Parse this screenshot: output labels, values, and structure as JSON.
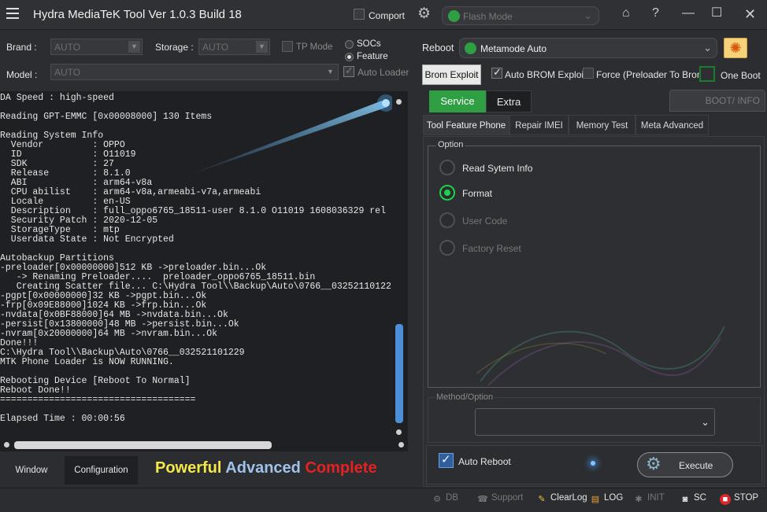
{
  "window": {
    "title": "Hydra MediaTeK Tool  Ver 1.0.3 Build 18",
    "comport_label": "Comport",
    "mode_label": "Flash Mode"
  },
  "controls": {
    "brand_label": "Brand :",
    "brand_value": "AUTO",
    "storage_label": "Storage :",
    "storage_value": "AUTO",
    "tp_mode_label": "TP Mode",
    "model_label": "Model :",
    "model_value": "AUTO",
    "socs_label": "SOCs",
    "feature_label": "Feature",
    "auto_loader_label": "Auto Loader",
    "reboot_label": "Reboot",
    "reboot_value": "Metamode Auto",
    "brom_exploit_label": "Brom Exploit",
    "auto_brom_label": "Auto BROM Exploit",
    "force_label": "Force (Preloader To Brom)",
    "one_boot_label": "One Boot"
  },
  "log": {
    "lines": "DA Speed : high-speed\n\nReading GPT-EMMC [0x00008000] 130 Items\n\nReading System Info\n  Vendor         : OPPO\n  ID             : O11019\n  SDK            : 27\n  Release        : 8.1.0\n  ABI            : arm64-v8a\n  CPU abilist    : arm64-v8a,armeabi-v7a,armeabi\n  Locale         : en-US\n  Description    : full_oppo6765_18511-user 8.1.0 O11019 1608036329 rel\n  Security Patch : 2020-12-05\n  StorageType    : mtp\n  Userdata State : Not Encrypted\n\nAutobackup Partitions\n-preloader[0x00000000]512 KB ->preloader.bin...Ok\n   -> Renaming Preloader....  preloader_oppo6765_18511.bin\n   Creating Scatter file... C:\\Hydra Tool\\\\Backup\\Auto\\0766__03252110122\n-pgpt[0x00000000]32 KB ->pgpt.bin...Ok\n-frp[0x09E88000]1024 KB ->frp.bin...Ok\n-nvdata[0x0BF88000]64 MB ->nvdata.bin...Ok\n-persist[0x13800000]48 MB ->persist.bin...Ok\n-nvram[0x20000000]64 MB ->nvram.bin...Ok\nDone!!!\nC:\\Hydra Tool\\\\Backup\\Auto\\0766__032521101229\nMTK Phone Loader is NOW RUNNING.\n\nRebooting Device [Reboot To Normal]\nReboot Done!!\n====================================\n\nElapsed Time : 00:00:56"
  },
  "bottom_tabs": [
    "Window",
    "Configuration"
  ],
  "slogan": {
    "word1": "Powerful",
    "word2": "Advanced",
    "word3": "Complete"
  },
  "main_tabs": [
    "Service",
    "Extra"
  ],
  "boot_info_label": "BOOT/ INFO",
  "sub_tabs": [
    "Tool Feature Phone",
    "Repair IMEI",
    "Memory Test",
    "Meta Advanced"
  ],
  "option": {
    "legend": "Option",
    "items": [
      "Read Sytem Info",
      "Format",
      "User Code",
      "Factory Reset"
    ]
  },
  "method_legend": "Method/Option",
  "auto_reboot_label": "Auto Reboot",
  "execute_label": "Execute",
  "status": [
    "DB",
    "Support",
    "ClearLog",
    "LOG",
    "INIT",
    "SC",
    "STOP"
  ],
  "colors": {
    "accent_green": "#1fd14a",
    "service_tab": "#2ea043",
    "slogan_yellow": "#f4e84a",
    "slogan_blue": "#9fc3ea",
    "slogan_red": "#e52222"
  }
}
